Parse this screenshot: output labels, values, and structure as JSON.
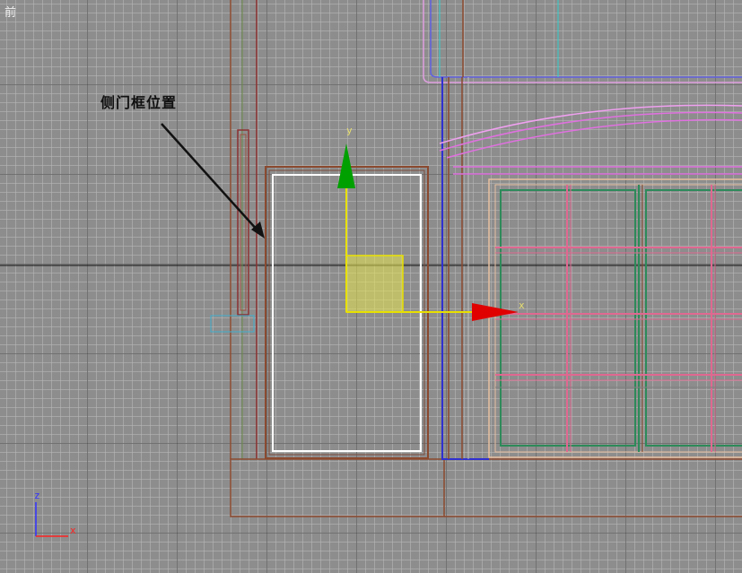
{
  "viewport": {
    "label": "前"
  },
  "annotation": {
    "text": "侧门框位置"
  },
  "gizmo": {
    "x_label": "x",
    "y_label": "y"
  },
  "axis_tripod": {
    "x_label": "x",
    "z_label": "z"
  },
  "colors": {
    "grid_major": "#464646",
    "grid_minor": "#b9b9b9",
    "frame_brown": "#8b4a2f",
    "selection_white": "#ffffff",
    "blue_wire": "#3030d0",
    "magenta_wire": "#e070e0",
    "pink_wire": "#e06890",
    "green_wire": "#2e8a5a",
    "gizmo_yellow": "#e8e000",
    "gizmo_red": "#e00000",
    "gizmo_green": "#00a000"
  }
}
